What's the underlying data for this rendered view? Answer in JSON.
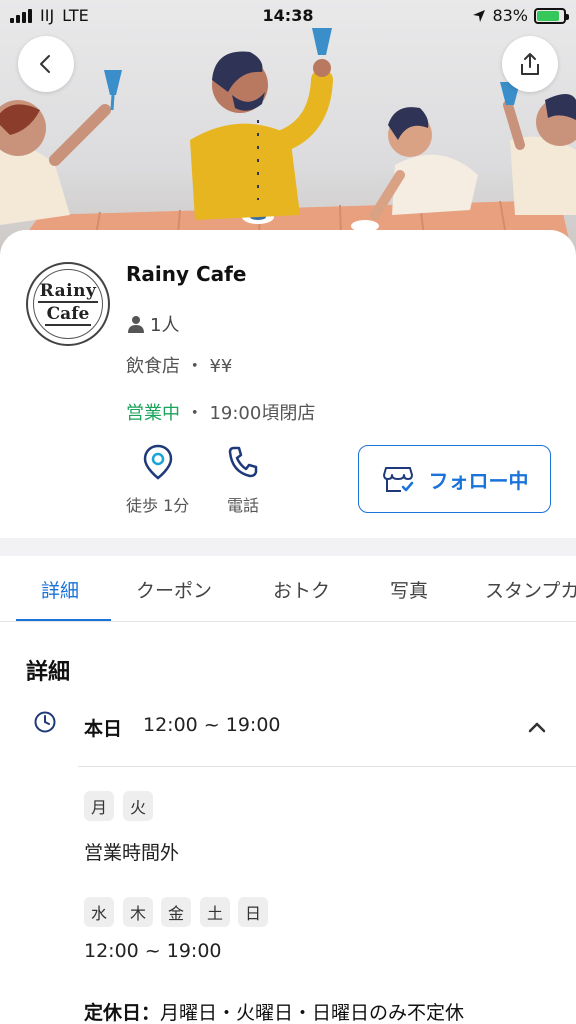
{
  "status_bar": {
    "carrier": "IIJ",
    "network": "LTE",
    "time": "14:38",
    "battery": "83%",
    "battery_level": 0.83
  },
  "shop": {
    "logo_line1": "Rainy",
    "logo_line2": "Cafe",
    "name": "Rainy Cafe",
    "followers": "1人",
    "category": "飲食店 ・ ¥¥",
    "status_open": "営業中",
    "status_close": " ・ 19:00頃閉店"
  },
  "actions": {
    "walk_label": "徒歩 1分",
    "phone_label": "電話",
    "follow_label": "フォロー中"
  },
  "tabs": [
    "詳細",
    "クーポン",
    "おトク",
    "写真",
    "スタンプカ"
  ],
  "detail": {
    "title": "詳細",
    "today_label": "本日",
    "today_hours": "12:00 ~ 19:00",
    "schedules": [
      {
        "days": [
          "月",
          "火"
        ],
        "text": "営業時間外"
      },
      {
        "days": [
          "水",
          "木",
          "金",
          "土",
          "日"
        ],
        "text": "12:00 ~ 19:00"
      }
    ],
    "closed_label": "定休日：",
    "closed_value": "月曜日・火曜日・日曜日のみ不定休"
  },
  "colors": {
    "accent": "#1a73d9",
    "open": "#1aa35a",
    "battery": "#35c759"
  }
}
